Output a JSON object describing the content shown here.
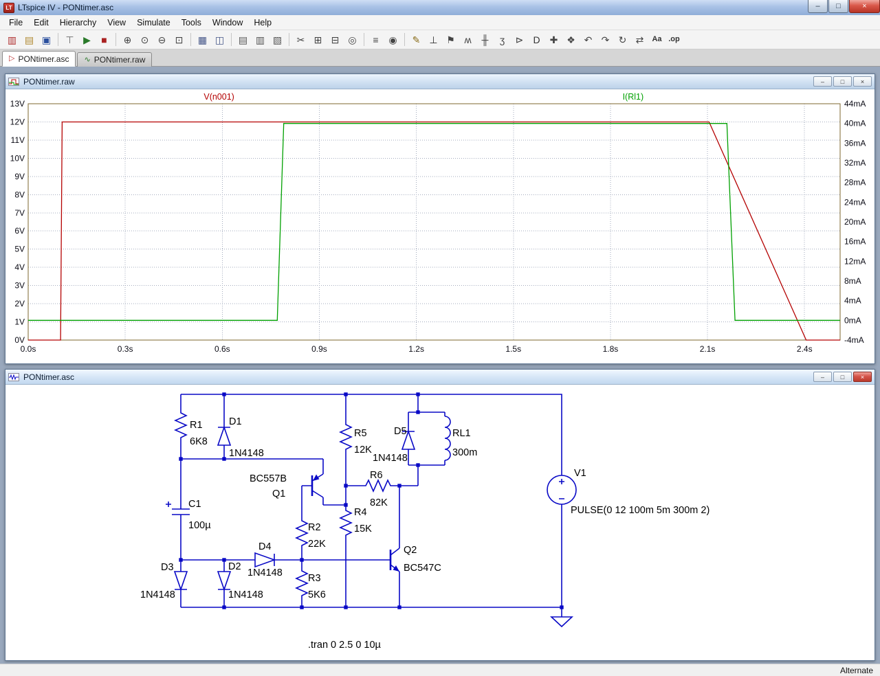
{
  "window": {
    "title": "LTspice IV - PONtimer.asc"
  },
  "menu": {
    "items": [
      "File",
      "Edit",
      "Hierarchy",
      "View",
      "Simulate",
      "Tools",
      "Window",
      "Help"
    ]
  },
  "toolbar": {
    "buttons": [
      {
        "name": "new-schematic",
        "glyph": "▥",
        "color": "#b03030"
      },
      {
        "name": "open-file",
        "glyph": "▤",
        "color": "#b08830"
      },
      {
        "name": "save",
        "glyph": "▣",
        "color": "#2a4f9e"
      },
      {
        "sep": true
      },
      {
        "name": "control-panel",
        "glyph": "⊤",
        "color": "#666666"
      },
      {
        "name": "run",
        "glyph": "▶",
        "color": "#2a7a2a"
      },
      {
        "name": "halt",
        "glyph": "■",
        "color": "#aa2222"
      },
      {
        "sep": true
      },
      {
        "name": "zoom-area",
        "glyph": "⊕",
        "color": "#444444"
      },
      {
        "name": "zoom-back",
        "glyph": "⊙",
        "color": "#444444"
      },
      {
        "name": "zoom-out",
        "glyph": "⊖",
        "color": "#444444"
      },
      {
        "name": "zoom-full-extents",
        "glyph": "⊡",
        "color": "#444444"
      },
      {
        "sep": true
      },
      {
        "name": "autorange",
        "glyph": "▦",
        "color": "#445588"
      },
      {
        "name": "plot-settings",
        "glyph": "◫",
        "color": "#445588"
      },
      {
        "sep": true
      },
      {
        "name": "tile-horizontal",
        "glyph": "▤",
        "color": "#555555"
      },
      {
        "name": "tile-vertical",
        "glyph": "▥",
        "color": "#555555"
      },
      {
        "name": "cascade-windows",
        "glyph": "▧",
        "color": "#555555"
      },
      {
        "sep": true
      },
      {
        "name": "cut",
        "glyph": "✂",
        "color": "#444444"
      },
      {
        "name": "copy",
        "glyph": "⊞",
        "color": "#444444"
      },
      {
        "name": "paste",
        "glyph": "⊟",
        "color": "#444444"
      },
      {
        "name": "find",
        "glyph": "◎",
        "color": "#444444"
      },
      {
        "sep": true
      },
      {
        "name": "print",
        "glyph": "≡",
        "color": "#444444"
      },
      {
        "name": "print-preview",
        "glyph": "◉",
        "color": "#444444"
      },
      {
        "sep": true
      },
      {
        "name": "wire",
        "glyph": "✎",
        "color": "#8a6d1a"
      },
      {
        "name": "ground",
        "glyph": "⊥",
        "color": "#333333"
      },
      {
        "name": "label-net",
        "glyph": "⚑",
        "color": "#444444"
      },
      {
        "name": "resistor",
        "glyph": "ʍ",
        "color": "#444444"
      },
      {
        "name": "capacitor",
        "glyph": "╫",
        "color": "#444444"
      },
      {
        "name": "inductor",
        "glyph": "ʒ",
        "color": "#444444"
      },
      {
        "name": "diode",
        "glyph": "⊳",
        "color": "#444444"
      },
      {
        "name": "component",
        "glyph": "D",
        "color": "#333333"
      },
      {
        "name": "move",
        "glyph": "✚",
        "color": "#444444"
      },
      {
        "name": "drag",
        "glyph": "❖",
        "color": "#444444"
      },
      {
        "name": "undo",
        "glyph": "↶",
        "color": "#444444"
      },
      {
        "name": "redo",
        "glyph": "↷",
        "color": "#444444"
      },
      {
        "name": "rotate",
        "glyph": "↻",
        "color": "#444444"
      },
      {
        "name": "mirror",
        "glyph": "⇄",
        "color": "#444444"
      },
      {
        "name": "text",
        "glyph": "Aa",
        "color": "#333333",
        "small": true
      },
      {
        "name": "spice-directive",
        "glyph": ".op",
        "color": "#333333",
        "small": true
      }
    ]
  },
  "tabs": [
    {
      "label": "PONtimer.asc"
    },
    {
      "label": "PONtimer.raw"
    }
  ],
  "plot_window": {
    "title": "P­ONtimer.raw"
  },
  "schematic_window": {
    "title": "PONtimer.asc"
  },
  "status_bar": {
    "right": "Alternate"
  },
  "chart_data": {
    "type": "line",
    "x_ticks": {
      "labels": [
        "0.0s",
        "0.3s",
        "0.6s",
        "0.9s",
        "1.2s",
        "1.5s",
        "1.8s",
        "2.1s",
        "2.4s"
      ],
      "values": [
        0,
        0.3,
        0.6,
        0.9,
        1.2,
        1.5,
        1.8,
        2.1,
        2.4
      ]
    },
    "y_left": {
      "labels": [
        "13V",
        "12V",
        "11V",
        "10V",
        "9V",
        "8V",
        "7V",
        "6V",
        "5V",
        "4V",
        "3V",
        "2V",
        "1V",
        "0V"
      ],
      "values": [
        13,
        12,
        11,
        10,
        9,
        8,
        7,
        6,
        5,
        4,
        3,
        2,
        1,
        0
      ]
    },
    "y_right": {
      "labels": [
        "44mA",
        "40mA",
        "36mA",
        "32mA",
        "28mA",
        "24mA",
        "20mA",
        "16mA",
        "12mA",
        "8mA",
        "4mA",
        "0mA",
        "-4mA"
      ],
      "values": [
        44,
        40,
        36,
        32,
        28,
        24,
        20,
        16,
        12,
        8,
        4,
        0,
        -4
      ]
    },
    "x_range": [
      0,
      2.51
    ],
    "y_left_range": [
      0,
      13
    ],
    "y_right_range": [
      -4,
      44
    ],
    "grid": true,
    "legend_position": "top",
    "series": [
      {
        "name": "V(n001)",
        "axis": "left",
        "color": "#b40000",
        "label_x": 0.59,
        "points": [
          [
            0,
            0
          ],
          [
            0.1,
            0
          ],
          [
            0.105,
            12
          ],
          [
            2.105,
            12
          ],
          [
            2.405,
            0
          ],
          [
            2.51,
            0
          ]
        ]
      },
      {
        "name": "I(Rl1)",
        "axis": "right",
        "color": "#00a000",
        "label_x": 1.87,
        "points": [
          [
            0,
            0
          ],
          [
            0.77,
            0
          ],
          [
            0.79,
            40
          ],
          [
            2.16,
            40
          ],
          [
            2.185,
            0
          ],
          [
            2.51,
            0
          ]
        ]
      }
    ]
  },
  "schematic": {
    "directive": ".tran 0 2.5 0 10µ",
    "components": {
      "r1": {
        "name": "R1",
        "value": "6K8"
      },
      "d1": {
        "name": "D1",
        "value": "1N4148"
      },
      "c1": {
        "name": "C1",
        "value": "100µ"
      },
      "d3": {
        "name": "D3",
        "value": "1N4148"
      },
      "d2": {
        "name": "D2",
        "value": "1N4148"
      },
      "d4": {
        "name": "D4",
        "value": "1N4148"
      },
      "r2": {
        "name": "R2",
        "value": "22K"
      },
      "r3": {
        "name": "R3",
        "value": "5K6"
      },
      "q1": {
        "name": "Q1",
        "value": "BC557B"
      },
      "r5": {
        "name": "R5",
        "value": "12K"
      },
      "r4": {
        "name": "R4",
        "value": "15K"
      },
      "r6": {
        "name": "R6",
        "value": "82K"
      },
      "d5": {
        "name": "D5",
        "value": "1N4148"
      },
      "rl1": {
        "name": "RL1",
        "value": "300m"
      },
      "q2": {
        "name": "Q2",
        "value": "BC547C"
      },
      "v1": {
        "name": "V1",
        "value": "PULSE(0 12 100m 5m 300m 2)"
      }
    }
  }
}
